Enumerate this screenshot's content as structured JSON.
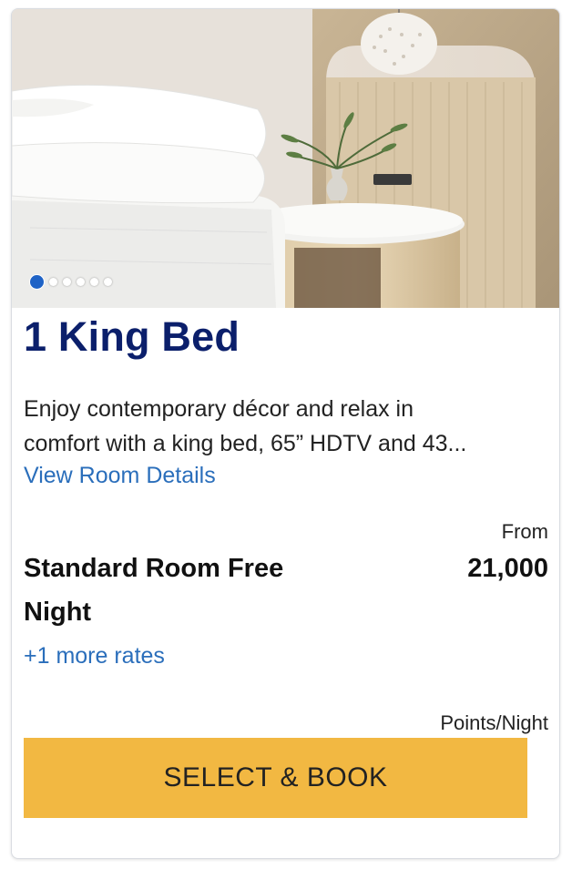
{
  "room": {
    "title": "1 King Bed",
    "description_line1": "Enjoy contemporary décor and relax in",
    "description_line2": "comfort with a king bed, 65” HDTV and 43...",
    "details_link": "View Room Details"
  },
  "carousel": {
    "image_count": 6,
    "active_index": 0,
    "active_color": "#1f63c6"
  },
  "rate": {
    "from_label": "From",
    "name": "Standard Room Free Night",
    "points": "21,000",
    "more_rates_link": "+1 more rates",
    "unit_label": "Points/Night"
  },
  "cta": {
    "label": "SELECT & BOOK",
    "color": "#f2b842"
  },
  "colors": {
    "title": "#0b1f6b",
    "link": "#2a6ebb"
  }
}
